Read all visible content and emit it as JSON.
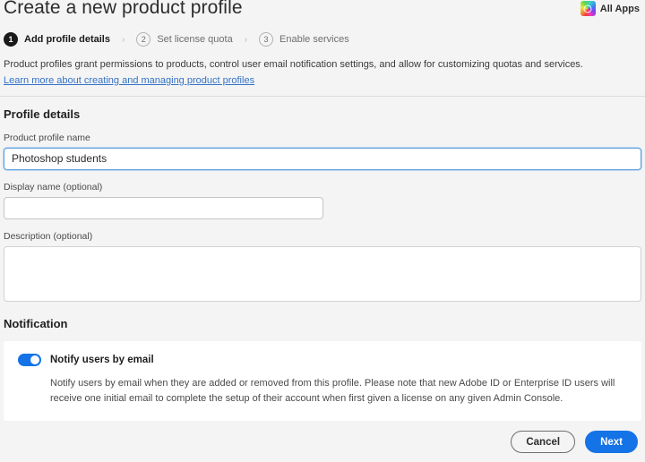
{
  "header": {
    "title": "Create a new product profile",
    "all_apps_label": "All Apps",
    "all_apps_icon": "creative-cloud-icon"
  },
  "steps": {
    "separator": "›",
    "items": [
      {
        "number": "1",
        "label": "Add profile details",
        "state": "active"
      },
      {
        "number": "2",
        "label": "Set license quota",
        "state": "idle"
      },
      {
        "number": "3",
        "label": "Enable services",
        "state": "idle"
      }
    ]
  },
  "intro": {
    "text": "Product profiles grant permissions to products, control user email notification settings, and allow for customizing quotas and services.",
    "link": "Learn more about creating and managing product profiles"
  },
  "profile_details": {
    "section_title": "Profile details",
    "name_label": "Product profile name",
    "name_value": "Photoshop students",
    "display_name_label": "Display name (optional)",
    "display_name_value": "",
    "description_label": "Description (optional)",
    "description_value": ""
  },
  "notification": {
    "section_title": "Notification",
    "toggle_label": "Notify users by email",
    "toggle_state": "on",
    "description": "Notify users by email when they are added or removed from this profile. Please note that new Adobe ID or Enterprise ID users will receive one initial email to complete the setup of their account when first given a license on any given Admin Console."
  },
  "footer": {
    "cancel_label": "Cancel",
    "next_label": "Next"
  },
  "colors": {
    "accent_blue": "#1473E6",
    "link_blue": "#3573C4",
    "page_background": "#F4F4F5",
    "card_background": "#FFFFFF",
    "focus_border": "#5E9FDC"
  }
}
